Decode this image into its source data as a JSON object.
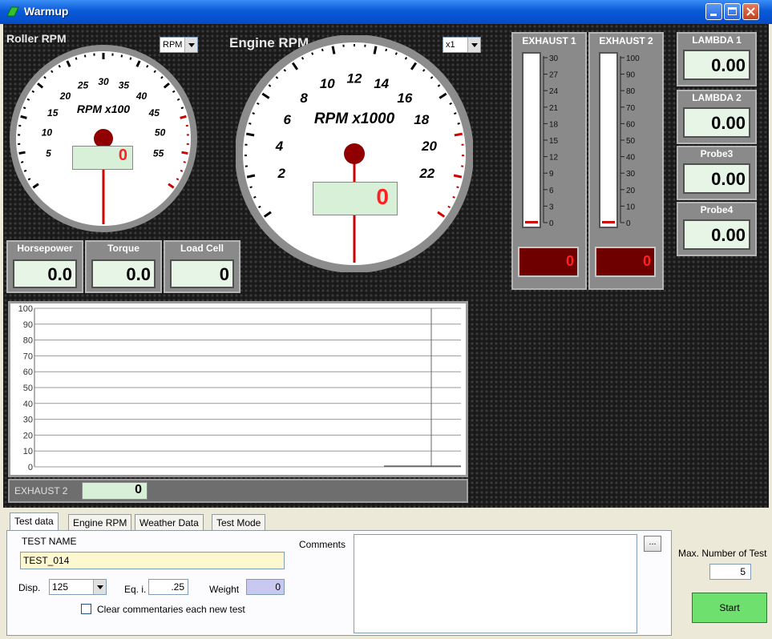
{
  "window": {
    "title": "Warmup"
  },
  "roller_gauge": {
    "title": "Roller RPM",
    "unit_select": "RPM",
    "scale_label": "RPM x100",
    "ticks": [
      "5",
      "10",
      "15",
      "20",
      "25",
      "30",
      "35",
      "40",
      "45",
      "50",
      "55"
    ],
    "readout": "0"
  },
  "engine_gauge": {
    "title": "Engine RPM",
    "unit_select": "x1",
    "scale_label": "RPM x1000",
    "ticks": [
      "2",
      "4",
      "6",
      "8",
      "10",
      "12",
      "14",
      "16",
      "18",
      "20",
      "22"
    ],
    "readout": "0"
  },
  "exhaust1": {
    "title": "EXHAUST 1",
    "ticks": [
      "30",
      "27",
      "24",
      "21",
      "18",
      "15",
      "12",
      "9",
      "6",
      "3",
      "0"
    ],
    "value": "0"
  },
  "exhaust2": {
    "title": "EXHAUST 2",
    "ticks": [
      "100",
      "90",
      "80",
      "70",
      "60",
      "50",
      "40",
      "30",
      "20",
      "10",
      "0"
    ],
    "value": "0"
  },
  "sensors": [
    {
      "label": "LAMBDA 1",
      "value": "0.00"
    },
    {
      "label": "LAMBDA 2",
      "value": "0.00"
    },
    {
      "label": "Probe3",
      "value": "0.00"
    },
    {
      "label": "Probe4",
      "value": "0.00"
    }
  ],
  "readouts": [
    {
      "label": "Horsepower",
      "value": "0.0"
    },
    {
      "label": "Torque",
      "value": "0.0"
    },
    {
      "label": "Load Cell",
      "value": "0"
    }
  ],
  "chart_data": {
    "type": "line",
    "title": "",
    "xlabel": "",
    "ylabel": "",
    "ylim": [
      0,
      100
    ],
    "y_ticks": [
      "100",
      "90",
      "80",
      "70",
      "60",
      "50",
      "40",
      "30",
      "20",
      "10",
      "0"
    ],
    "grid": true,
    "series": []
  },
  "chart_footer": {
    "label": "EXHAUST 2",
    "value": "0"
  },
  "tabs": [
    "Test data",
    "Engine RPM",
    "Weather Data",
    "Test Mode"
  ],
  "form": {
    "test_name_label": "TEST NAME",
    "test_name_value": "TEST_014",
    "disp_label": "Disp.",
    "disp_value": "125",
    "eqi_label": "Eq. i.",
    "eqi_value": ".25",
    "weight_label": "Weight",
    "weight_value": "0",
    "clear_label": "Clear commentaries each new test",
    "comments_label": "Comments",
    "browse_label": "...",
    "max_tests_label": "Max. Number of Test",
    "max_tests_value": "5",
    "start_label": "Start"
  },
  "colors": {
    "needle": "#d00000",
    "readout_bg": "#e6f5e6",
    "start_button": "#6ee06e"
  }
}
